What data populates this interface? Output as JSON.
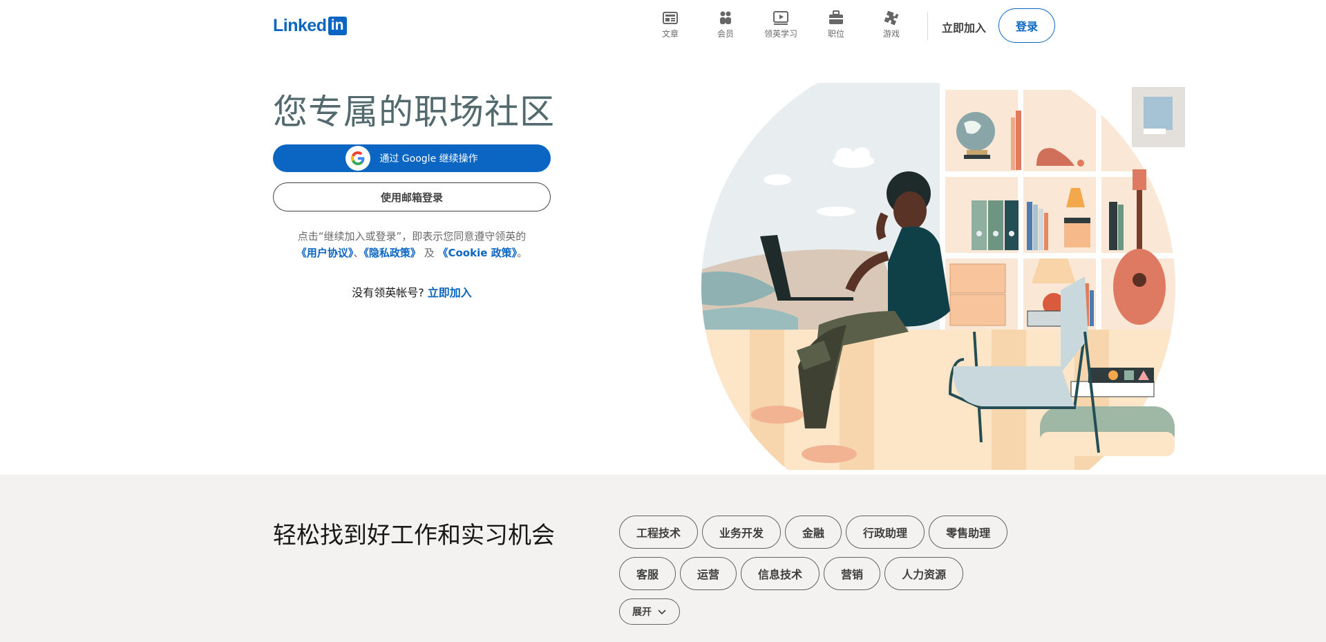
{
  "header": {
    "logo_text": "Linked",
    "logo_box": "in",
    "nav": [
      {
        "label": "文章",
        "icon": "articles-icon"
      },
      {
        "label": "会员",
        "icon": "people-icon"
      },
      {
        "label": "领英学习",
        "icon": "learning-icon"
      },
      {
        "label": "职位",
        "icon": "jobs-icon"
      },
      {
        "label": "游戏",
        "icon": "games-icon"
      }
    ],
    "join_label": "立即加入",
    "signin_label": "登录"
  },
  "hero": {
    "title": "您专属的职场社区",
    "google_button_label": "通过 Google 继续操作",
    "email_button_label": "使用邮箱登录",
    "agree_prefix": "点击“继续加入或登录”，即表示您同意遵守领英的",
    "user_agreement": "《用户协议》",
    "separator": "、",
    "privacy_policy": "《隐私政策》",
    "and_text": " 及 ",
    "cookie_policy": "《Cookie 政策》",
    "period": "。",
    "no_account_text": "没有领英帐号? ",
    "join_now_link": "立即加入"
  },
  "jobs": {
    "title": "轻松找到好工作和实习机会",
    "row1": [
      "工程技术",
      "业务开发",
      "金融",
      "行政助理",
      "零售助理"
    ],
    "row2": [
      "客服",
      "运营",
      "信息技术",
      "营销",
      "人力资源"
    ],
    "expand_label": "展开"
  },
  "colors": {
    "brand": "#0a66c2",
    "title_gray": "#526a6e",
    "bottom_bg": "#f3f2f0"
  }
}
